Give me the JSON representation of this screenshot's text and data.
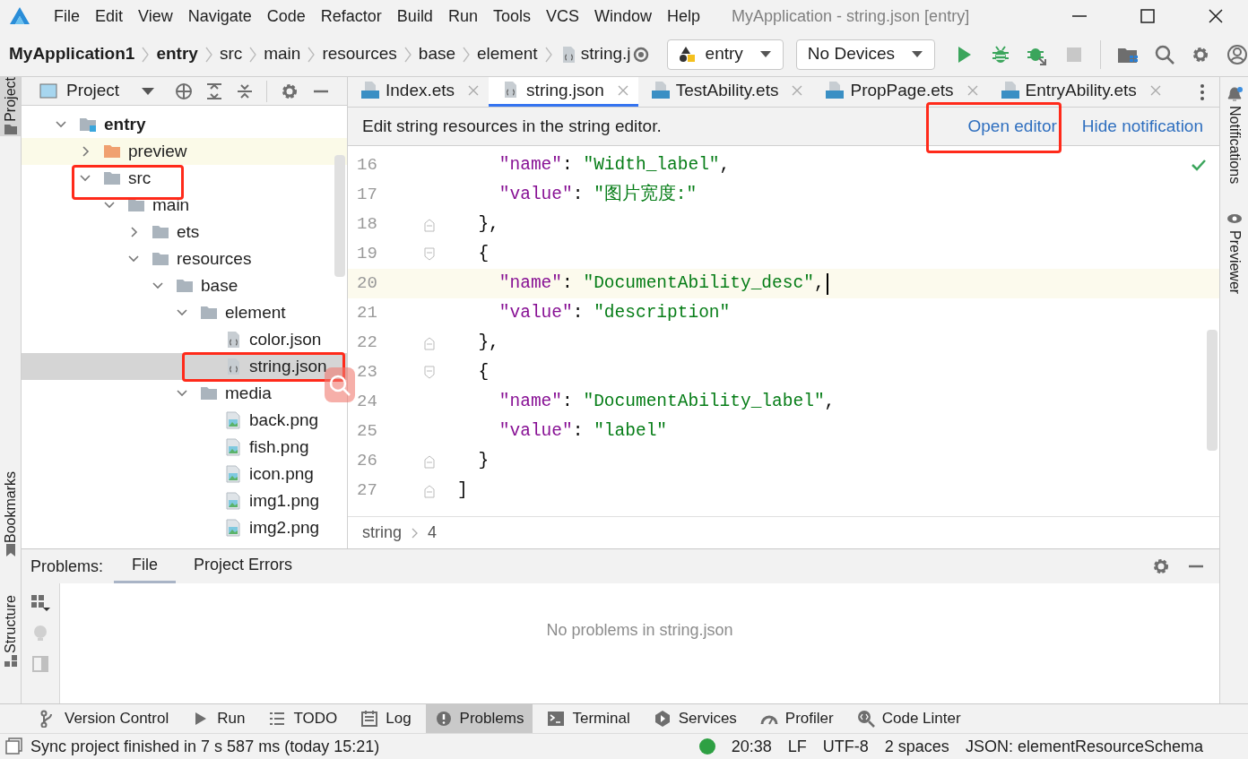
{
  "menu_bar": {
    "items": [
      "File",
      "Edit",
      "View",
      "Navigate",
      "Code",
      "Refactor",
      "Build",
      "Run",
      "Tools",
      "VCS",
      "Window",
      "Help"
    ],
    "title": "MyApplication - string.json [entry]"
  },
  "navigation_bar": {
    "breadcrumbs": [
      {
        "label": "MyApplication1",
        "bold": true
      },
      {
        "label": "entry",
        "bold": true
      },
      {
        "label": "src",
        "bold": false
      },
      {
        "label": "main",
        "bold": false
      },
      {
        "label": "resources",
        "bold": false
      },
      {
        "label": "base",
        "bold": false
      },
      {
        "label": "element",
        "bold": false
      },
      {
        "label": "string.j",
        "bold": false,
        "kind": "json"
      }
    ],
    "config_selector": "entry",
    "device_selector": "No Devices"
  },
  "left_stripe": [
    {
      "label": "Project",
      "selected": true
    },
    {
      "label": "Bookmarks",
      "selected": false
    },
    {
      "label": "Structure",
      "selected": false
    }
  ],
  "right_stripe": [
    {
      "label": "Notifications"
    },
    {
      "label": "Previewer"
    }
  ],
  "project_panel": {
    "title": "Project",
    "tree": [
      {
        "label": "entry",
        "kind": "module",
        "expanded": true,
        "selected": false,
        "children": [
          {
            "label": "preview",
            "kind": "generated",
            "expanded": false,
            "selected": false
          },
          {
            "label": "src",
            "kind": "folder",
            "expanded": true,
            "selected": false,
            "children": [
              {
                "label": "main",
                "kind": "folder",
                "expanded": true,
                "selected": false,
                "children": [
                  {
                    "label": "ets",
                    "kind": "folder",
                    "expanded": false,
                    "selected": false
                  },
                  {
                    "label": "resources",
                    "kind": "folder",
                    "expanded": true,
                    "selected": false,
                    "children": [
                      {
                        "label": "base",
                        "kind": "folder",
                        "expanded": true,
                        "selected": false,
                        "children": [
                          {
                            "label": "element",
                            "kind": "folder",
                            "expanded": true,
                            "selected": false,
                            "children": [
                              {
                                "label": "color.json",
                                "kind": "json",
                                "selected": false
                              },
                              {
                                "label": "string.json",
                                "kind": "json",
                                "selected": true
                              }
                            ]
                          },
                          {
                            "label": "media",
                            "kind": "folder",
                            "expanded": true,
                            "selected": false,
                            "children": [
                              {
                                "label": "back.png",
                                "kind": "image",
                                "selected": false
                              },
                              {
                                "label": "fish.png",
                                "kind": "image",
                                "selected": false
                              },
                              {
                                "label": "icon.png",
                                "kind": "image",
                                "selected": false
                              },
                              {
                                "label": "img1.png",
                                "kind": "image",
                                "selected": false
                              },
                              {
                                "label": "img2.png",
                                "kind": "image",
                                "selected": false
                              }
                            ]
                          }
                        ]
                      }
                    ]
                  }
                ]
              }
            ]
          }
        ]
      }
    ]
  },
  "editor": {
    "tabs": [
      {
        "label": "Index.ets",
        "kind": "ets",
        "selected": false
      },
      {
        "label": "string.json",
        "kind": "json",
        "selected": true
      },
      {
        "label": "TestAbility.ets",
        "kind": "ets",
        "selected": false
      },
      {
        "label": "PropPage.ets",
        "kind": "ets",
        "selected": false
      },
      {
        "label": "EntryAbility.ets",
        "kind": "ets",
        "selected": false
      }
    ],
    "notification": {
      "message": "Edit string resources in the string editor.",
      "actions": [
        "Open editor",
        "Hide notification"
      ]
    },
    "lines": [
      {
        "number": "16",
        "text": "    \"name\": \"Width_label\",",
        "current": false
      },
      {
        "number": "17",
        "text": "    \"value\": \"图片宽度:\"",
        "current": false
      },
      {
        "number": "18",
        "text": "  },",
        "current": false,
        "fold_end": true
      },
      {
        "number": "19",
        "text": "  {",
        "current": false,
        "fold_start": true
      },
      {
        "number": "20",
        "text": "    \"name\": \"DocumentAbility_desc\",",
        "current": true
      },
      {
        "number": "21",
        "text": "    \"value\": \"description\"",
        "current": false
      },
      {
        "number": "22",
        "text": "  },",
        "current": false,
        "fold_end": true
      },
      {
        "number": "23",
        "text": "  {",
        "current": false,
        "fold_start": true
      },
      {
        "number": "24",
        "text": "    \"name\": \"DocumentAbility_label\",",
        "current": false
      },
      {
        "number": "25",
        "text": "    \"value\": \"label\"",
        "current": false
      },
      {
        "number": "26",
        "text": "  }",
        "current": false,
        "fold_end": true
      },
      {
        "number": "27",
        "text": "]",
        "current": false,
        "fold_end": true
      }
    ],
    "breadcrumb": [
      "string",
      "4"
    ]
  },
  "problems_panel": {
    "title": "Problems:",
    "tabs": [
      {
        "label": "File",
        "selected": true
      },
      {
        "label": "Project Errors",
        "selected": false
      }
    ],
    "message": "No problems in string.json"
  },
  "tool_windows": [
    {
      "label": "Version Control",
      "kind": "vcs",
      "selected": false
    },
    {
      "label": "Run",
      "kind": "run",
      "selected": false
    },
    {
      "label": "TODO",
      "kind": "todo",
      "selected": false
    },
    {
      "label": "Log",
      "kind": "log",
      "selected": false
    },
    {
      "label": "Problems",
      "kind": "problems",
      "selected": true
    },
    {
      "label": "Terminal",
      "kind": "terminal",
      "selected": false
    },
    {
      "label": "Services",
      "kind": "services",
      "selected": false
    },
    {
      "label": "Profiler",
      "kind": "profiler",
      "selected": false
    },
    {
      "label": "Code Linter",
      "kind": "linter",
      "selected": false
    }
  ],
  "status_bar": {
    "message": "Sync project finished in 7 s 587 ms (today 15:21)",
    "items": [
      "20:38",
      "LF",
      "UTF-8",
      "2 spaces",
      "JSON: elementResourceSchema"
    ]
  }
}
